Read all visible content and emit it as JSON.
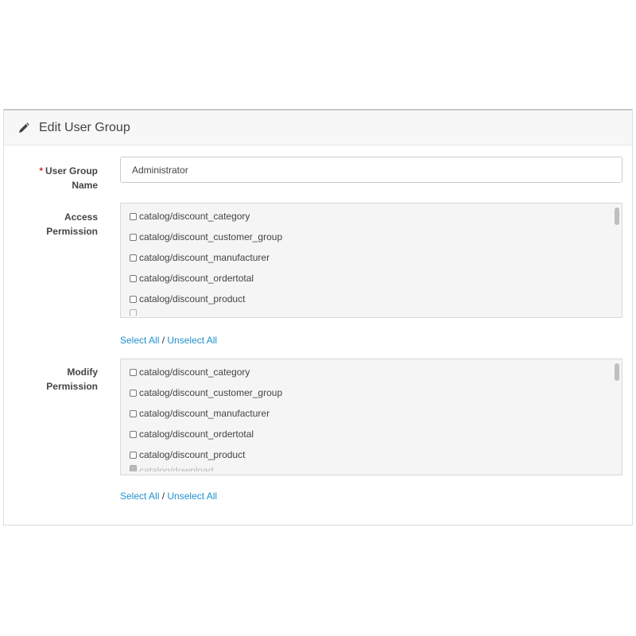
{
  "panel": {
    "title": "Edit User Group",
    "icon": "pencil-icon"
  },
  "form": {
    "user_group_name": {
      "required_mark": "*",
      "label_line1": "User Group",
      "label_line2": "Name",
      "value": "Administrator"
    },
    "access_permission": {
      "label_line1": "Access",
      "label_line2": "Permission",
      "items": [
        {
          "label": "catalog/discount_category",
          "checked": false
        },
        {
          "label": "catalog/discount_customer_group",
          "checked": false
        },
        {
          "label": "catalog/discount_manufacturer",
          "checked": false
        },
        {
          "label": "catalog/discount_ordertotal",
          "checked": false
        },
        {
          "label": "catalog/discount_product",
          "checked": false
        }
      ],
      "select_all": "Select All",
      "separator": "/",
      "unselect_all": "Unselect All"
    },
    "modify_permission": {
      "label_line1": "Modify",
      "label_line2": "Permission",
      "items": [
        {
          "label": "catalog/discount_category",
          "checked": false
        },
        {
          "label": "catalog/discount_customer_group",
          "checked": false
        },
        {
          "label": "catalog/discount_manufacturer",
          "checked": false
        },
        {
          "label": "catalog/discount_ordertotal",
          "checked": false
        },
        {
          "label": "catalog/discount_product",
          "checked": false
        },
        {
          "label": "catalog/download",
          "checked": true
        }
      ],
      "select_all": "Select All",
      "separator": "/",
      "unselect_all": "Unselect All"
    }
  },
  "colors": {
    "link": "#1e91cf",
    "required": "#d9302a",
    "well_background": "#f5f5f5"
  }
}
